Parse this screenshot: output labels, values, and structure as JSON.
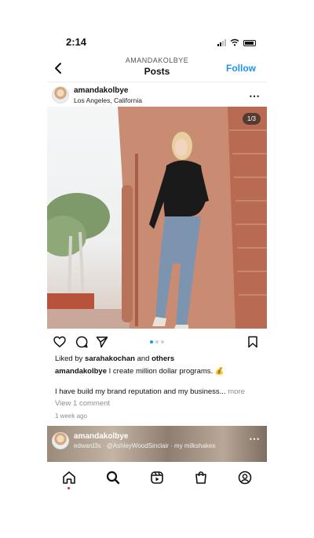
{
  "status_bar": {
    "time": "2:14"
  },
  "header": {
    "username": "AMANDAKOLBYE",
    "title": "Posts",
    "follow_label": "Follow"
  },
  "post": {
    "username": "amandakolbye",
    "location": "Los Angeles, California",
    "image_counter": "1/3",
    "carousel": {
      "total": 3,
      "active": 1
    },
    "liked_prefix": "Liked by ",
    "liked_user": "sarahakochan",
    "liked_and": " and ",
    "liked_others": "others",
    "caption_user": "amandakolbye",
    "caption_text": " I create million dollar programs. 💰",
    "caption_more_text": "I have build my brand reputation and my business...",
    "more_label": " more",
    "comments_label": "View 1 comment",
    "time_ago": "1 week ago"
  },
  "next_post": {
    "username": "amandakolbye",
    "subtitle": "edward3s · @AshleyWoodSinclair · my milkshakes"
  },
  "icons": {
    "back": "chevron-left-icon",
    "more": "more-horizontal-icon",
    "like": "heart-icon",
    "comment": "comment-icon",
    "share": "send-icon",
    "save": "bookmark-icon",
    "home": "home-icon",
    "search": "search-icon",
    "reels": "reels-icon",
    "shop": "shop-icon",
    "profile": "profile-icon"
  },
  "colors": {
    "accent": "#1a95f0",
    "notification": "#e0245e"
  }
}
